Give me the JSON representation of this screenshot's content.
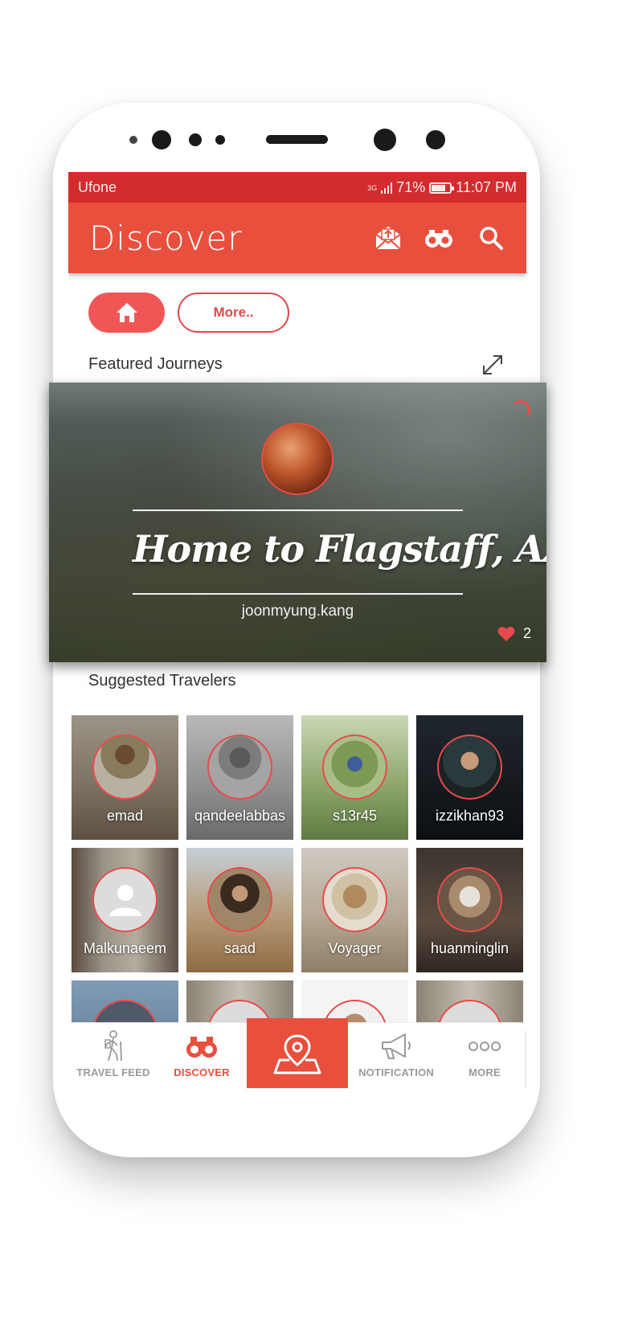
{
  "status_bar": {
    "carrier": "Ufone",
    "network": "3G",
    "battery": "71%",
    "time": "11:07 PM"
  },
  "app_bar": {
    "title": "Discover",
    "icons": [
      "mail-upload-icon",
      "binoculars-icon",
      "search-icon"
    ]
  },
  "filters": {
    "home_icon": "home-icon",
    "more_label": "More.."
  },
  "featured": {
    "section_title": "Featured Journeys",
    "expand_icon": "expand-icon",
    "journey_title": "Home to Flagstaff, AZ",
    "author": "joonmyung.kang",
    "likes": "2"
  },
  "suggested": {
    "section_title": "Suggested Travelers",
    "travelers": [
      {
        "name": "emad"
      },
      {
        "name": "qandeelabbas"
      },
      {
        "name": "s13r45"
      },
      {
        "name": "izzikhan93"
      },
      {
        "name": "Malkunaeem"
      },
      {
        "name": "saad"
      },
      {
        "name": "Voyager"
      },
      {
        "name": "huanminglin"
      }
    ]
  },
  "bottom_nav": {
    "items": [
      {
        "label": "TRAVEL FEED",
        "icon": "hiker-icon"
      },
      {
        "label": "DISCOVER",
        "icon": "binoculars-icon",
        "active": true
      },
      {
        "label": "",
        "icon": "map-pin-icon"
      },
      {
        "label": "NOTIFICATION",
        "icon": "megaphone-icon"
      },
      {
        "label": "MORE",
        "icon": "more-dots-icon"
      }
    ]
  },
  "colors": {
    "accent": "#e8503d",
    "status_bar": "#d42c2e",
    "accent_text": "#e4474b",
    "nav_inactive": "#9a9a9a"
  }
}
